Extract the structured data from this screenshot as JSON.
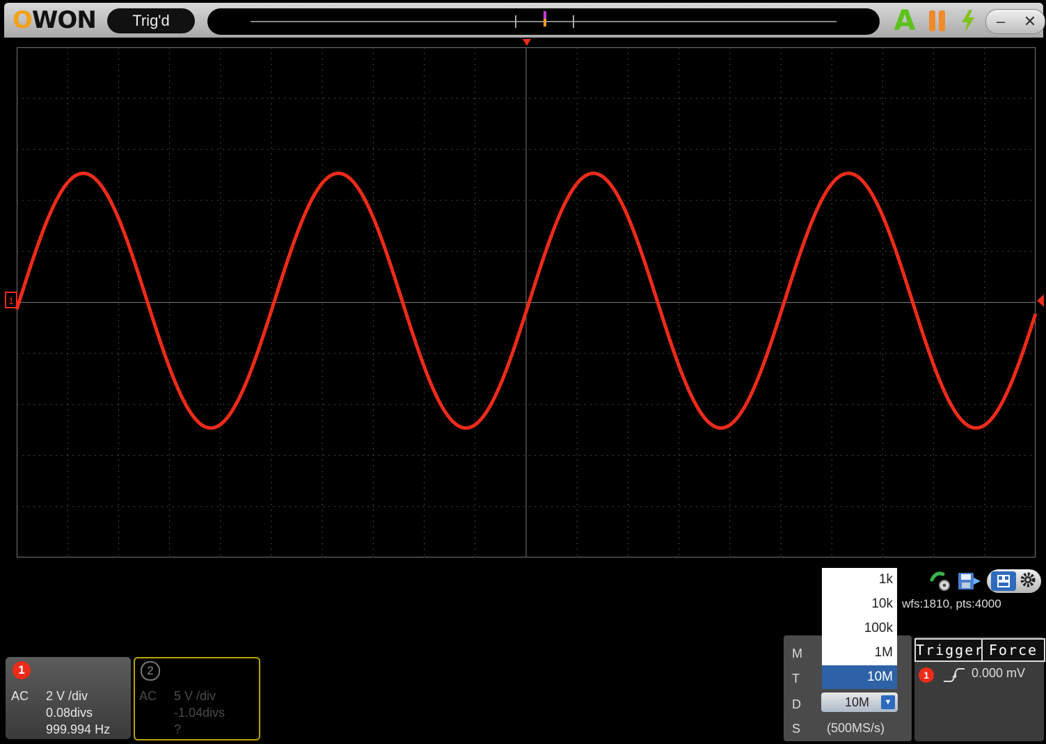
{
  "titlebar": {
    "logo": "OWON",
    "status": "Trig'd",
    "auto_label": "A",
    "window_min": "–",
    "window_close": "✕"
  },
  "scope": {
    "ch1_marker": "1"
  },
  "channels": [
    {
      "num": "1",
      "coupling": "AC",
      "scale": "2 V /div",
      "offset": "0.08divs",
      "freq": "999.994 Hz",
      "color": "#ee2b1a"
    },
    {
      "num": "2",
      "coupling": "AC",
      "scale": "5 V /div",
      "offset": "-1.04divs",
      "freq": "?",
      "color": "#b8a400"
    }
  ],
  "acquisition": {
    "labels": {
      "m": "M",
      "t": "T",
      "d": "D",
      "s": "S"
    },
    "depth_options": [
      "1k",
      "10k",
      "100k",
      "1M",
      "10M"
    ],
    "selected_depth": "10M",
    "depth_value": "10M",
    "sample_rate": "(500MS/s)",
    "status_text": "wfs:1810, pts:4000"
  },
  "trigger": {
    "trigger_button": "Trigger",
    "force_button": "Force",
    "source": "1",
    "level": "0.000 mV"
  }
}
